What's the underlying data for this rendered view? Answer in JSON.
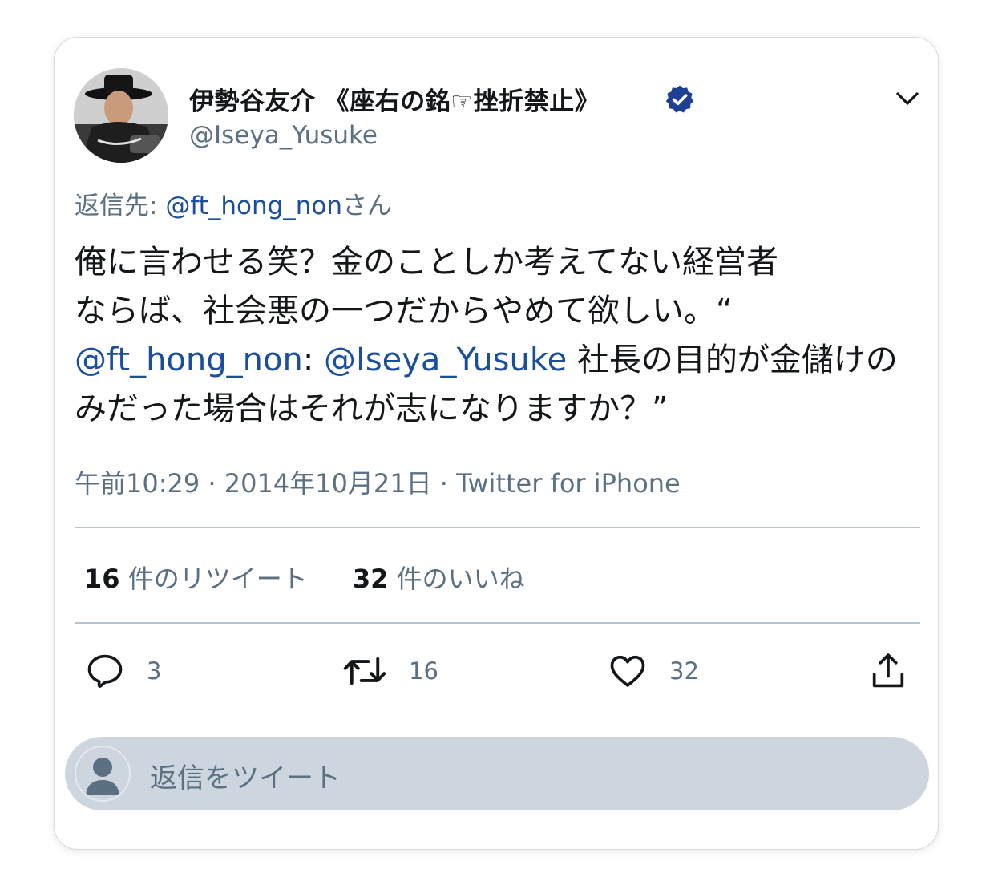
{
  "tweet": {
    "display_name": "伊勢谷友介 《座右の銘☞挫折禁止》",
    "handle": "@Iseya_Yusuke",
    "reply_to_prefix": "返信先: ",
    "reply_to_mention": "@ft_hong_non",
    "reply_to_suffix": "さん",
    "body": {
      "line1": "俺に言わせる笑？金のことしか考えてない経営者",
      "line2": "ならば、社会悪の一つだからやめて欲しい。“",
      "line3_mention1": "@ft_hong_non",
      "line3_colon": ": ",
      "line3_mention2": "@Iseya_Yusuke",
      "line3_text": " 社長の目的が金儲けの",
      "line4": "みだった場合はそれが志になりますか？”"
    },
    "meta": "午前10:29 · 2014年10月21日 · Twitter for iPhone",
    "stats": {
      "retweets_count": "16",
      "retweets_label": " 件のリツイート",
      "likes_count": "32",
      "likes_label": " 件のいいね"
    },
    "actions": {
      "reply_icon": "reply-bubble-icon",
      "reply_count": "3",
      "retweet_icon": "retweet-icon",
      "retweet_count": "16",
      "like_icon": "heart-icon",
      "like_count": "32",
      "share_icon": "share-icon"
    },
    "reply_box_placeholder": "返信をツイート"
  },
  "colors": {
    "link": "#1b4f9c",
    "verified": "#1d3f94",
    "secondary_text": "#5b7083",
    "reply_box_bg": "#cdd6de"
  }
}
